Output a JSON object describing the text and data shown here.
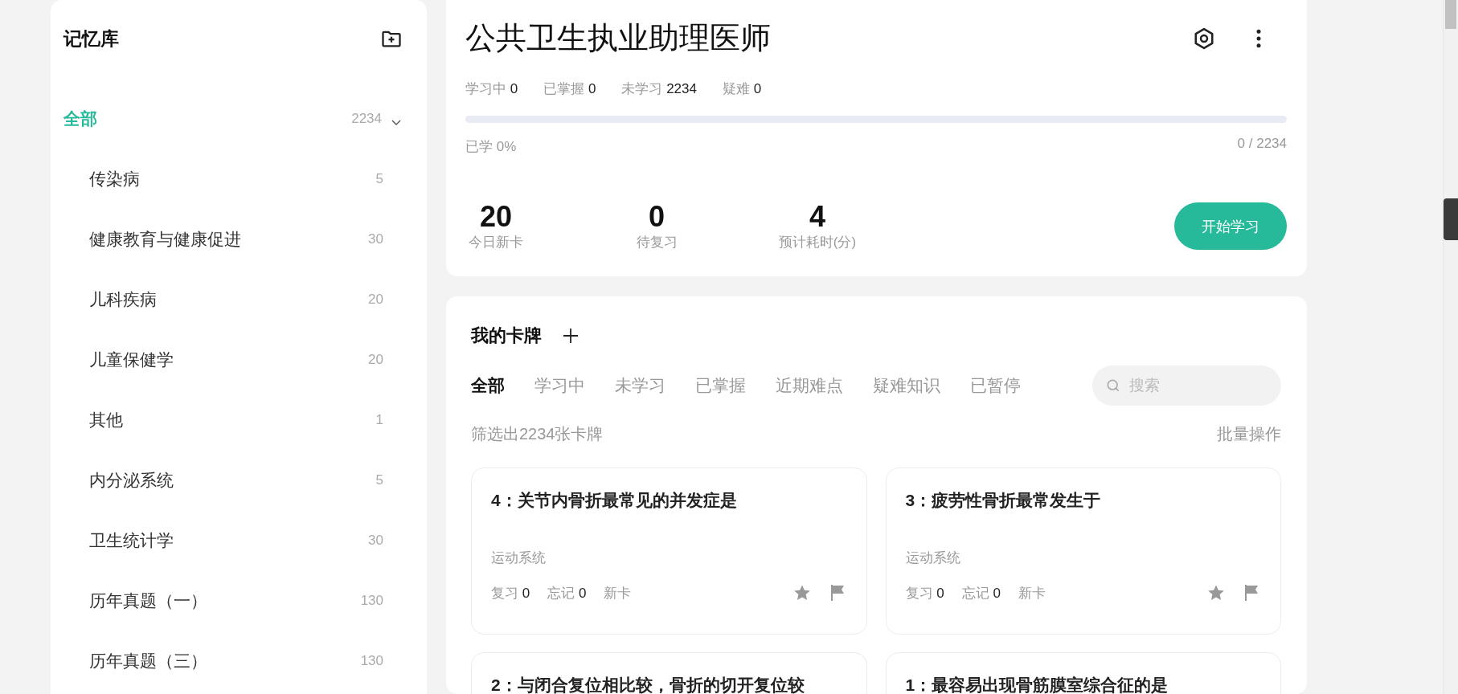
{
  "sidebar": {
    "title": "记忆库",
    "tree": {
      "label": "全部",
      "count": "2234",
      "selected": true,
      "expanded": true,
      "children": [
        {
          "label": "传染病",
          "count": "5",
          "selected": false
        },
        {
          "label": "健康教育与健康促进",
          "count": "30",
          "selected": false
        },
        {
          "label": "儿科疾病",
          "count": "20",
          "selected": false
        },
        {
          "label": "儿童保健学",
          "count": "20",
          "selected": false
        },
        {
          "label": "其他",
          "count": "1",
          "selected": false
        },
        {
          "label": "内分泌系统",
          "count": "5",
          "selected": false
        },
        {
          "label": "卫生统计学",
          "count": "30",
          "selected": false
        },
        {
          "label": "历年真题（一）",
          "count": "130",
          "selected": false
        },
        {
          "label": "历年真题（三）",
          "count": "130",
          "selected": false
        }
      ]
    }
  },
  "deck": {
    "title": "公共卫生执业助理医师",
    "stats": [
      {
        "label": "学习中",
        "value": "0"
      },
      {
        "label": "已掌握",
        "value": "0"
      },
      {
        "label": "未学习",
        "value": "2234"
      },
      {
        "label": "疑难",
        "value": "0"
      }
    ],
    "progress": {
      "level": 0,
      "label": "已学 0%",
      "reading": "0 / 2234"
    },
    "summary": [
      {
        "value": "20",
        "label": "今日新卡"
      },
      {
        "value": "0",
        "label": "待复习"
      },
      {
        "value": "4",
        "label": "预计耗时(分)"
      }
    ],
    "start_button": "开始学习"
  },
  "cards_panel": {
    "title": "我的卡牌",
    "tabs": [
      {
        "label": "全部",
        "selected": true
      },
      {
        "label": "学习中",
        "selected": false
      },
      {
        "label": "未学习",
        "selected": false
      },
      {
        "label": "已掌握",
        "selected": false
      },
      {
        "label": "近期难点",
        "selected": false
      },
      {
        "label": "疑难知识",
        "selected": false
      },
      {
        "label": "已暂停",
        "selected": false
      }
    ],
    "search": {
      "placeholder": "搜索"
    },
    "filter_text": "筛选出2234张卡牌",
    "batch_action": "批量操作",
    "cards": [
      {
        "title": "4：关节内骨折最常见的并发症是",
        "category": "运动系统",
        "review_label": "复习",
        "review": "0",
        "forget_label": "忘记",
        "forget": "0",
        "status": "新卡"
      },
      {
        "title": "3：疲劳性骨折最常发生于",
        "category": "运动系统",
        "review_label": "复习",
        "review": "0",
        "forget_label": "忘记",
        "forget": "0",
        "status": "新卡"
      },
      {
        "title": "2：与闭合复位相比较，骨折的切开复位较"
      },
      {
        "title": "1：最容易出现骨筋膜室综合征的是"
      }
    ]
  }
}
